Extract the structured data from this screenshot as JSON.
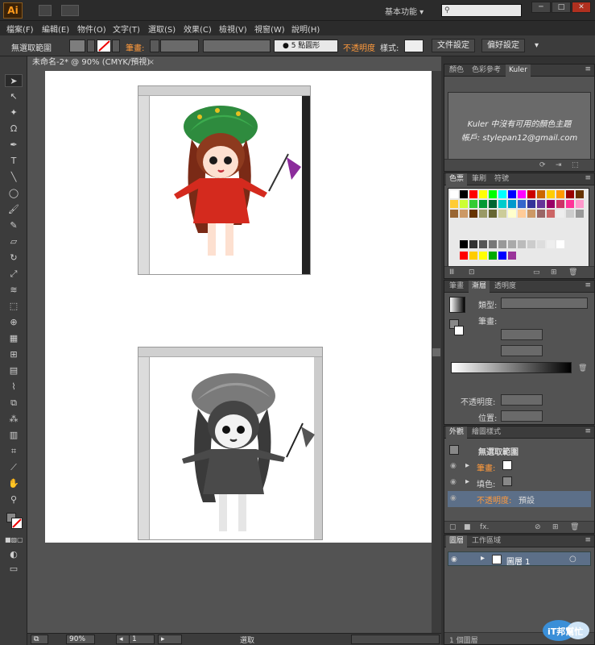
{
  "app": {
    "logo": "Ai",
    "workspace": "基本功能 ▾",
    "search_icon": "search-icon",
    "window_controls": [
      "─",
      "□",
      "✕"
    ]
  },
  "menu": [
    "檔案(F)",
    "編輯(E)",
    "物件(O)",
    "文字(T)",
    "選取(S)",
    "效果(C)",
    "檢視(V)",
    "視窗(W)",
    "說明(H)"
  ],
  "control": {
    "selection": "無選取範圍",
    "stroke_label": "筆畫:",
    "brush": "● 5 點圓形",
    "opacity_label": "不透明度",
    "style_label": "樣式:",
    "doc_setup": "文件設定",
    "preferences": "偏好設定",
    "arrange_icon": "▾"
  },
  "document": {
    "tab": "未命名-2* @ 90% (CMYK/預視)",
    "close": "×"
  },
  "status": {
    "zoom": "90%",
    "page": "1",
    "mode": "選取"
  },
  "kuler": {
    "tabs": [
      "顏色",
      "色彩參考",
      "Kuler"
    ],
    "message": "Kuler 中沒有可用的顏色主題",
    "account": "帳戶: stylepan12@gmail.com"
  },
  "swatches": {
    "tabs": [
      "色票",
      "筆刷",
      "符號"
    ],
    "row1": [
      "#ffffff",
      "#000000",
      "#ff0000",
      "#ffff00",
      "#00ff00",
      "#00ffff",
      "#0000ff",
      "#ff00ff",
      "#cc0000",
      "#cc6600",
      "#ffcc00",
      "#ff9900",
      "#990000",
      "#663300"
    ],
    "row2": [
      "#ffcc33",
      "#ccff33",
      "#33cc33",
      "#009933",
      "#006633",
      "#00cccc",
      "#0099cc",
      "#3366cc",
      "#333399",
      "#663399",
      "#990066",
      "#cc3366",
      "#ff3399",
      "#ff99cc"
    ],
    "row3": [
      "#996633",
      "#cc9966",
      "#663300",
      "#999966",
      "#666633",
      "#cccc99",
      "#ffffcc",
      "#ffcc99",
      "#cc9966",
      "#996666",
      "#cc6666",
      "#eeeeee",
      "#cccccc",
      "#999999"
    ],
    "greys": [
      "#000000",
      "#333333",
      "#555555",
      "#777777",
      "#999999",
      "#aaaaaa",
      "#bbbbbb",
      "#cccccc",
      "#dddddd",
      "#eeeeee",
      "#ffffff"
    ],
    "brights": [
      "#ff0000",
      "#ffcc00",
      "#ffff00",
      "#00aa00",
      "#0000ff",
      "#993399"
    ]
  },
  "gradient": {
    "tabs": [
      "筆畫",
      "漸層",
      "透明度"
    ],
    "type_label": "類型:",
    "stroke_label": "筆畫:",
    "opacity_label": "不透明度:",
    "position_label": "位置:"
  },
  "appearance": {
    "tabs": [
      "外觀",
      "繪圖樣式"
    ],
    "header": "無選取範圍",
    "stroke_label": "筆畫:",
    "fill_label": "填色:",
    "opacity_label": "不透明度:",
    "opacity_value": "預設",
    "fx": "fx."
  },
  "layers": {
    "tabs": [
      "圖層",
      "工作區域"
    ],
    "layer_name": "圖層 1",
    "count": "1 個圖層"
  },
  "badge": {
    "text": "iT邦幫忙"
  }
}
